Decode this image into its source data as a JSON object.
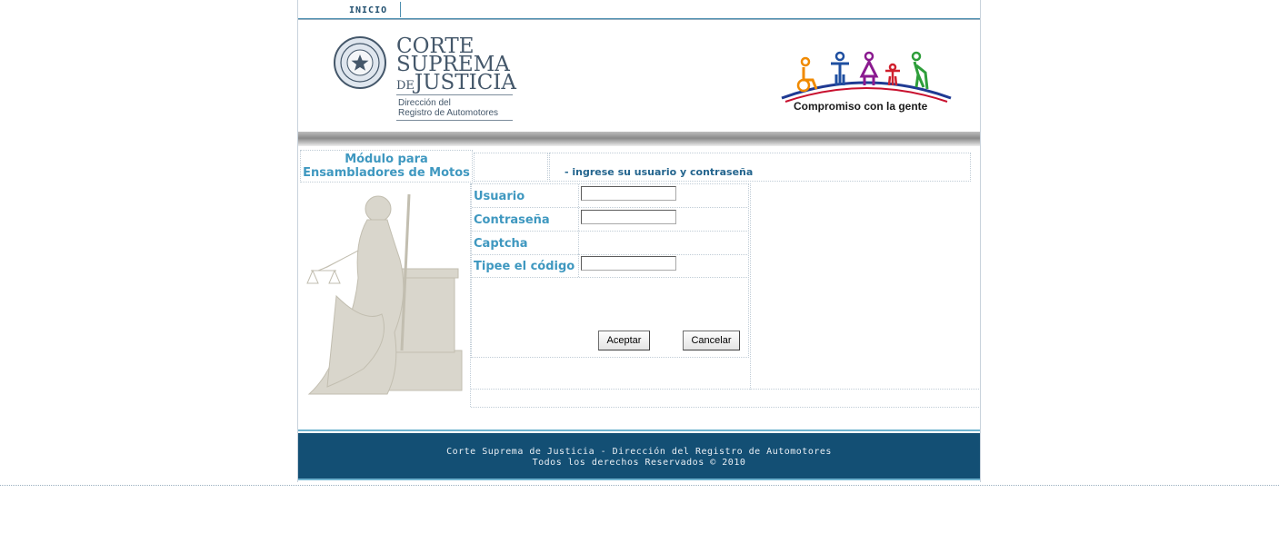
{
  "nav": {
    "inicio": "INICIO"
  },
  "header": {
    "org_line1": "CORTE",
    "org_line2": "SUPREMA",
    "org_line3_small": "DE",
    "org_line3": "JUSTICIA",
    "dept_line1": "Dirección del",
    "dept_line2": "Registro de Automotores",
    "campaign": "Compromiso con la gente"
  },
  "module": {
    "title_line1": "Módulo para",
    "title_line2": "Ensambladores de Motos",
    "instruction": "- ingrese su usuario y contraseña"
  },
  "form": {
    "usuario_label": "Usuario",
    "usuario_value": "",
    "password_label": "Contraseña",
    "password_value": "",
    "captcha_label": "Captcha",
    "code_label": "Tipee el código",
    "code_value": "",
    "accept_label": "Aceptar",
    "cancel_label": "Cancelar"
  },
  "footer": {
    "line1": "Corte Suprema de Justicia - Dirección del Registro de Automotores",
    "line2": "Todos los derechos Reservados © 2010"
  },
  "colors": {
    "accent": "#3f98c0",
    "footer_bg": "#134f74",
    "nav_text": "#1f4e6e"
  }
}
